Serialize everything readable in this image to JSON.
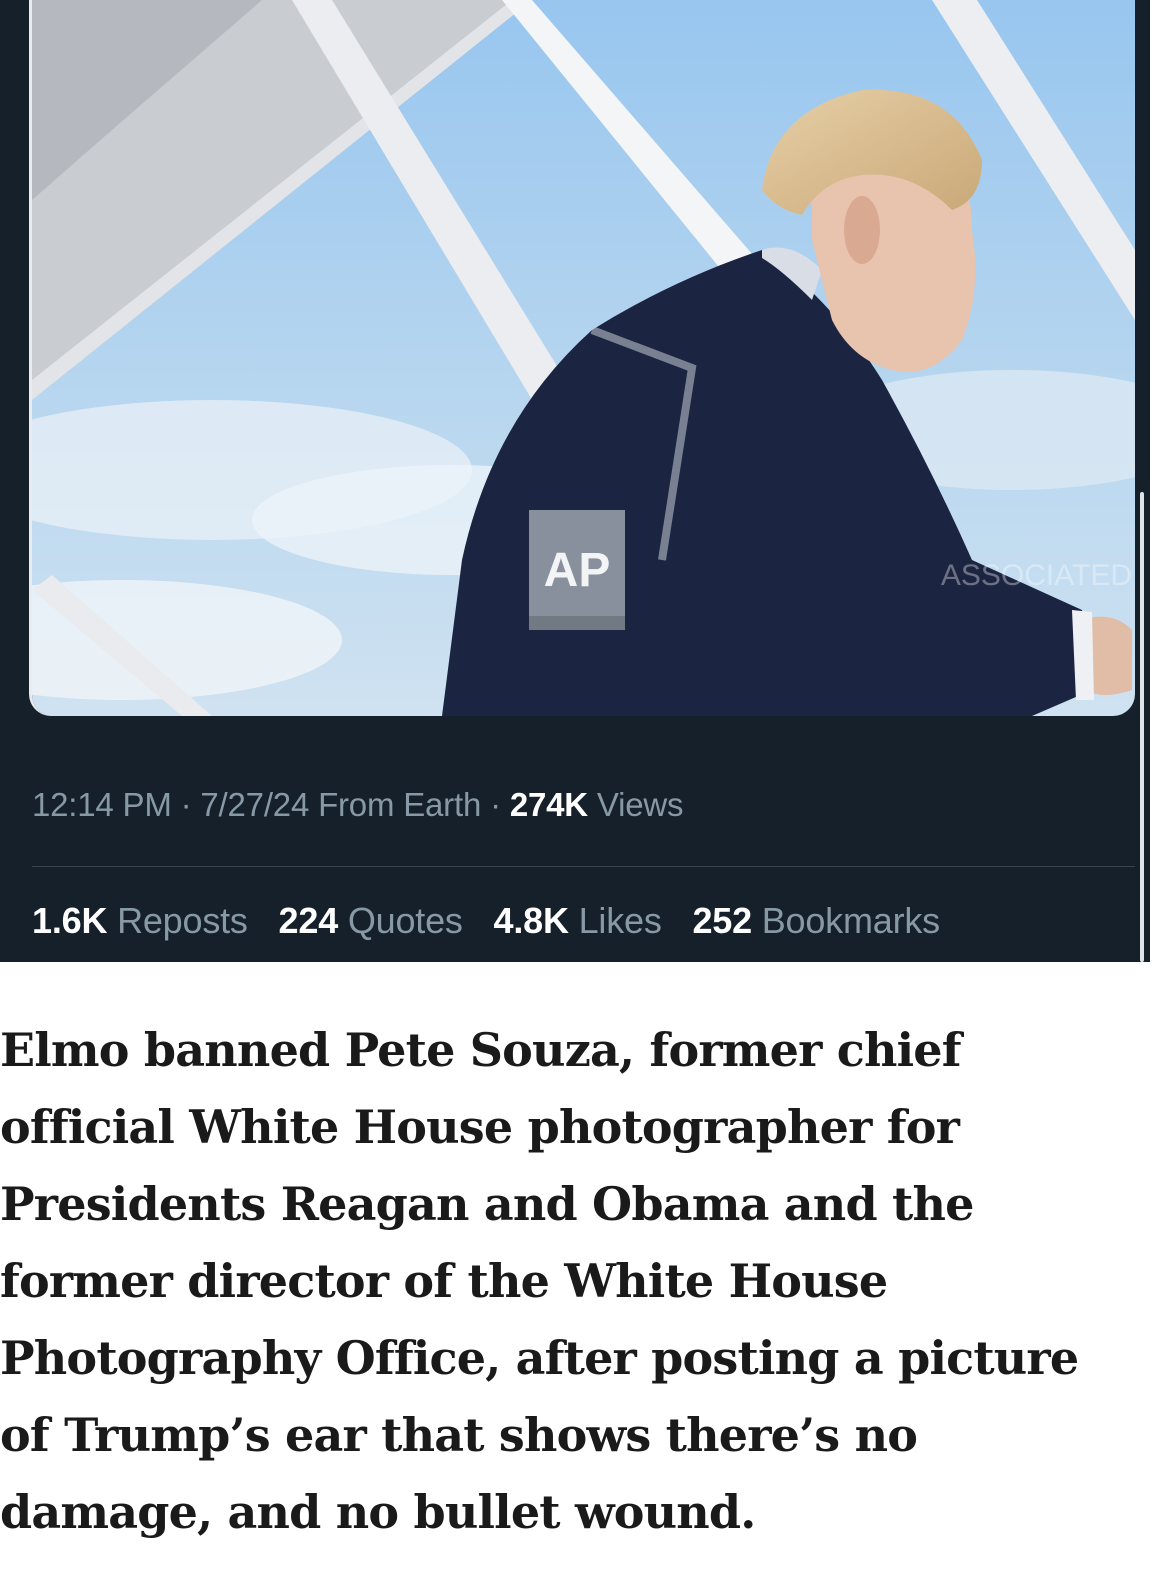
{
  "tweet": {
    "image": {
      "watermark_label": "AP",
      "watermark_side_text": "ASSOCIATED",
      "sky_color": "#a9cdec",
      "suit_color": "#1b2440"
    },
    "meta": {
      "time": "12:14 PM",
      "sep1": "·",
      "date": "7/27/24",
      "source": "From Earth",
      "sep2": "·",
      "views_count": "274K",
      "views_label": "Views"
    },
    "stats": [
      {
        "count": "1.6K",
        "label": "Reposts"
      },
      {
        "count": "224",
        "label": "Quotes"
      },
      {
        "count": "4.8K",
        "label": "Likes"
      },
      {
        "count": "252",
        "label": "Bookmarks"
      }
    ]
  },
  "caption": {
    "lines": [
      "Elmo banned Pete Souza, former chief",
      "official White House photographer for",
      "Presidents Reagan and Obama and the",
      "former director of the White House",
      "Photography Office, after posting a picture",
      "of Trump’s ear that shows there’s no",
      "damage, and no bullet wound."
    ]
  },
  "colors": {
    "card_bg": "#15202b",
    "muted_text": "#8899a6",
    "strong_text": "#ffffff"
  }
}
